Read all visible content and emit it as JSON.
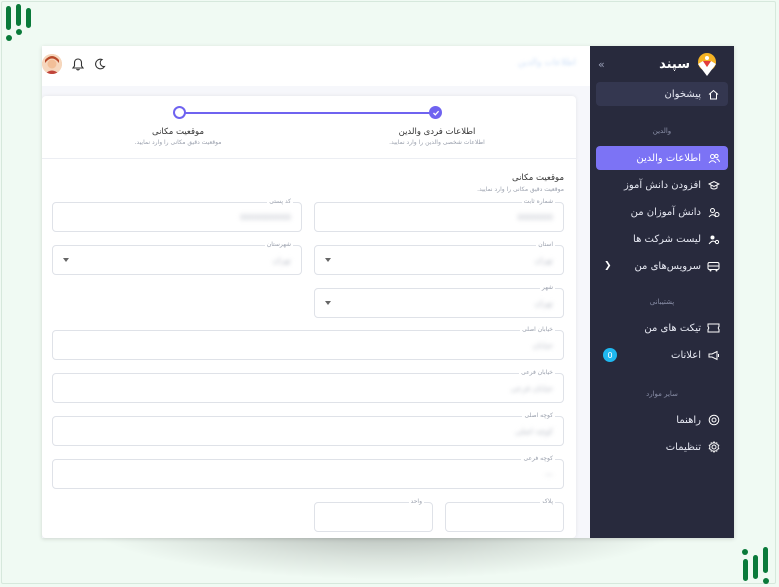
{
  "brand": {
    "name": "سپند"
  },
  "sidebar": {
    "home": "پیشخوان",
    "section_parents": "والدین",
    "items_parents": [
      {
        "label": "اطلاعات والدین",
        "icon": "users-icon",
        "active": true
      },
      {
        "label": "افزودن دانش آموز",
        "icon": "graduation-cap-icon",
        "active": false
      },
      {
        "label": "دانش آموزان من",
        "icon": "students-icon",
        "active": false
      },
      {
        "label": "لیست شرکت ها",
        "icon": "user-gear-icon",
        "active": false
      },
      {
        "label": "سرویس‌های من",
        "icon": "bus-icon",
        "active": false
      }
    ],
    "section_support": "پشتیبانی",
    "items_support": [
      {
        "label": "تیکت های من",
        "icon": "ticket-icon"
      },
      {
        "label": "اعلانات",
        "icon": "megaphone-icon",
        "badge": "0"
      }
    ],
    "section_other": "سایر موارد",
    "items_other": [
      {
        "label": "راهنما",
        "icon": "help-ring-icon"
      },
      {
        "label": "تنظیمات",
        "icon": "gear-icon"
      }
    ]
  },
  "topbar": {
    "title": "اطلاعات والدین"
  },
  "steps": [
    {
      "title": "اطلاعات فردی والدین",
      "subtitle": "اطلاعات شخصی والدین را وارد نمایید."
    },
    {
      "title": "موقعیت مکانی",
      "subtitle": "موقعیت دقیق مکانی را وارد نمایید."
    }
  ],
  "form": {
    "title": "موقعیت مکانی",
    "subtitle": "موقعیت دقیق مکانی را وارد نمایید.",
    "fields": {
      "landline": {
        "label": "شماره ثابت",
        "value": "0000000"
      },
      "postal": {
        "label": "کد پستی",
        "value": "0000000000"
      },
      "province": {
        "label": "استان",
        "value": "تهران"
      },
      "county": {
        "label": "شهرستان",
        "value": "تهران"
      },
      "city": {
        "label": "شهر",
        "value": "تهران"
      },
      "main_street": {
        "label": "خیابان اصلی",
        "value": "خیابان"
      },
      "side_street": {
        "label": "خیابان فرعی",
        "value": "خیابان فرعی"
      },
      "main_alley": {
        "label": "کوچه اصلی",
        "value": "کوچه اصلی"
      },
      "side_alley": {
        "label": "کوچه فرعی",
        "value": "—"
      },
      "plaque": {
        "label": "پلاک",
        "value": ""
      },
      "unit": {
        "label": "واحد",
        "value": ""
      }
    }
  }
}
